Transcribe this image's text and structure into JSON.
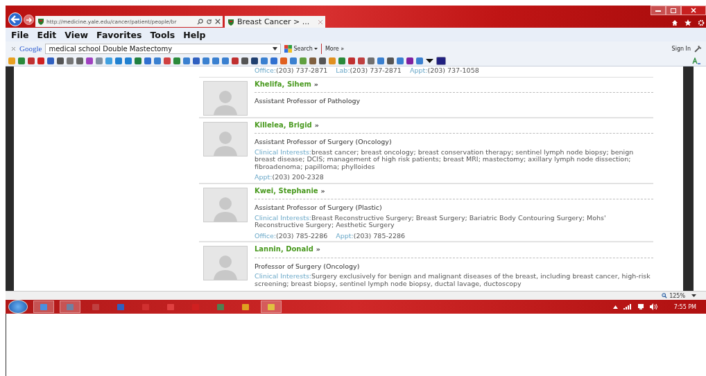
{
  "browser": {
    "url": "http://medicine.yale.edu/cancer/patient/people/br",
    "tab_title": "Breast Cancer > ...",
    "menu": [
      "File",
      "Edit",
      "View",
      "Favorites",
      "Tools",
      "Help"
    ],
    "google_toolbar": {
      "logo": "Google",
      "query": "medical school Double Mastectomy",
      "search": "Search",
      "more": "More »",
      "sign_in": "Sign In"
    }
  },
  "content": {
    "top_contacts": [
      {
        "label": "Office:",
        "value": "(203) 737-2871"
      },
      {
        "label": "Lab:",
        "value": "(203) 737-2871"
      },
      {
        "label": "Appt:",
        "value": "(203) 737-1058"
      }
    ],
    "people": [
      {
        "name": "Khelifa, Sihem",
        "arrow": "»",
        "title": "Assistant Professor of Pathology"
      },
      {
        "name": "Killelea, Brigid",
        "arrow": "»",
        "title": "Assistant Professor of Surgery (Oncology)",
        "interests_label": "Clinical Interests:",
        "interests": "breast cancer; breast oncology; breast conservation therapy; sentinel lymph node biopsy; benign breast disease; DCIS; management of high risk patients; breast MRI; mastectomy; axillary lymph node dissection; fibroadenoma; papilloma; phylloides",
        "contacts": [
          {
            "label": "Appt:",
            "value": "(203) 200-2328"
          }
        ]
      },
      {
        "name": "Kwei, Stephanie",
        "arrow": "»",
        "title": "Assistant Professor of Surgery (Plastic)",
        "interests_label": "Clinical Interests:",
        "interests": "Breast Reconstructive Surgery; Breast Surgery; Bariatric Body Contouring Surgery; Mohs' Reconstructive Surgery; Aesthetic Surgery",
        "contacts": [
          {
            "label": "Office:",
            "value": "(203) 785-2286"
          },
          {
            "label": "Appt:",
            "value": "(203) 785-2286"
          }
        ]
      },
      {
        "name": "Lannin, Donald",
        "arrow": "»",
        "title": "Professor of Surgery (Oncology)",
        "interests_label": "Clinical Interests:",
        "interests": "Surgery exclusively for benign and malignant diseases of the breast, including breast cancer, high-risk screening; breast biopsy, sentinel lymph node biopsy, ductal lavage, ductoscopy"
      }
    ]
  },
  "status_bar": {
    "zoom": "125%"
  },
  "taskbar": {
    "clock": "7:55 PM"
  }
}
